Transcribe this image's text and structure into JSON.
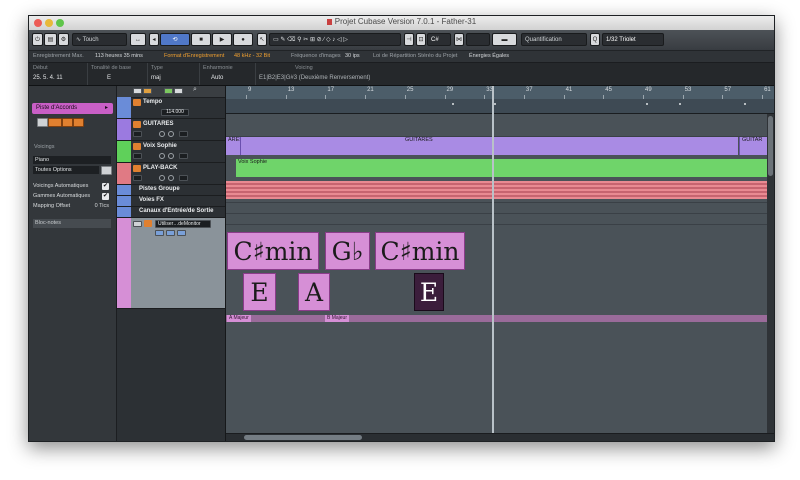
{
  "window": {
    "title": "Projet Cubase Version 7.0.1 - Father-31"
  },
  "toolbar": {
    "mode_value": "Touch",
    "snap_value": "C#",
    "quantize_label": "Quantification",
    "quantize_value": "1/32 Triolet"
  },
  "status": {
    "rec_max_label": "Enregistrement Max.",
    "rec_max_value": "113 heures 35 mins",
    "rec_format_label": "Format d'Enregistrement",
    "rec_format_value": "48 kHz - 32 Bit",
    "framerate_label": "Fréquence d'images",
    "framerate_value": "30 ips",
    "pan_law_label": "Loi de Répartition Stéréo du Projet",
    "pan_law_value": "Énergies Égales"
  },
  "infoline": {
    "start_label": "Début",
    "start_value": "25. 5. 4. 11",
    "key_label": "Tonalité de base",
    "key_value": "E",
    "type_label": "Type",
    "type_value": "maj",
    "tension_label": "Enharmonie",
    "tension_value": "Auto",
    "voicing_label": "Voicing",
    "voicing_value": "E1|B2|E3|G#3 (Deuxième Renversement)"
  },
  "inspector": {
    "track_name": "Piste d'Accords",
    "voicings_label": "Voicings",
    "voicing_library": "Piano",
    "voicing_option": "Toutes Options",
    "auto_voicings_label": "Voicings Automatiques",
    "auto_scales_label": "Gammes Automatiques",
    "mapping_label": "Mapping Offset",
    "mapping_value": "0 Tics",
    "notepad_label": "Bloc-notes"
  },
  "tracks": {
    "tempo_name": "Tempo",
    "tempo_value": "114.000",
    "guitars_name": "GUITARES",
    "voice_name": "Voix Sophie",
    "playback_name": "PLAY-BACK",
    "groups_name": "Pistes Groupe",
    "fx_name": "Voies FX",
    "io_name": "Canaux d'Entrée/de Sortie",
    "chord_sub_name": "Utiliser…deMonitor"
  },
  "ruler": {
    "bars": [
      "9",
      "13",
      "17",
      "21",
      "25",
      "29",
      "33",
      "37",
      "41",
      "45",
      "49",
      "53",
      "57",
      "61"
    ]
  },
  "parts": {
    "guitars_left": "ARES",
    "guitars_main": "GUITARES",
    "guitars_right": "GUITAR",
    "voice": "Voix Sophie"
  },
  "chords": {
    "c1": "C♯min",
    "c2": "G♭",
    "c3": "C♯min",
    "c4": "E",
    "c5": "A",
    "c6": "E"
  },
  "scales": {
    "s1": "A Majeur",
    "s2": "B Majeur"
  },
  "colors": {
    "tempo": "#6a8cd8",
    "guitars": "#9b7ae0",
    "voice": "#5fd05a",
    "playback": "#e07a84",
    "chord": "#d68fd6"
  }
}
